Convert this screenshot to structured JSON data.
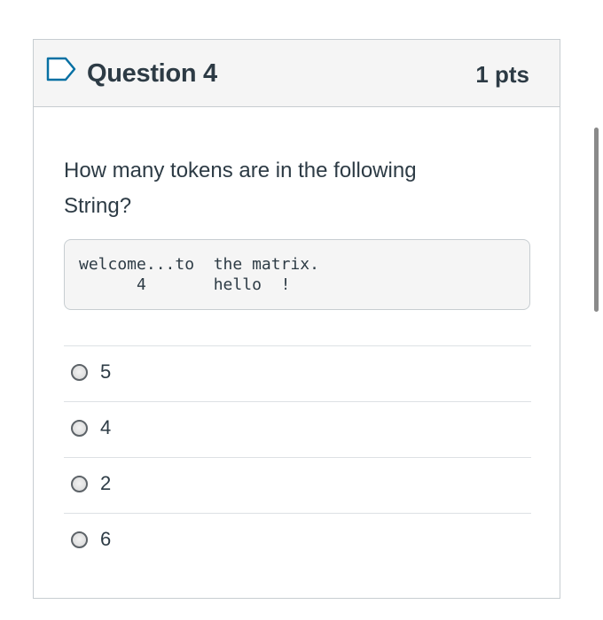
{
  "question": {
    "title": "Question 4",
    "points": "1 pts",
    "flag_icon": "bookmark-flag-icon",
    "text": "How many tokens are in the following String?",
    "code": "welcome...to  the matrix.\n      4       hello  !"
  },
  "answers": [
    {
      "label": "5",
      "selected": false
    },
    {
      "label": "4",
      "selected": false
    },
    {
      "label": "2",
      "selected": false
    },
    {
      "label": "6",
      "selected": false
    }
  ],
  "colors": {
    "text": "#2d3b45",
    "header_background": "#f5f5f5",
    "border": "#c7cdd1"
  }
}
